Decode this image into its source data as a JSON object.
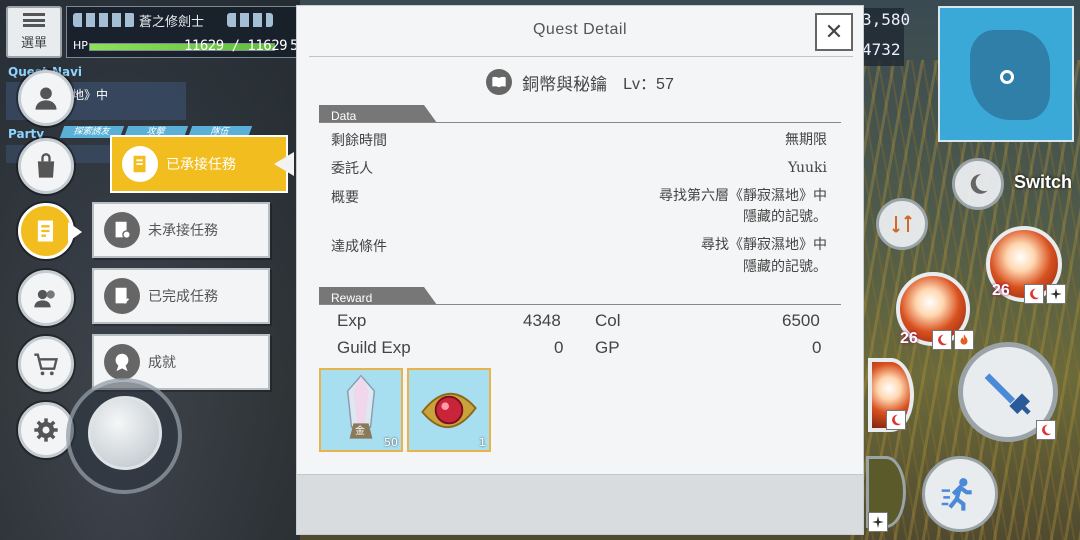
{
  "hud": {
    "menu_label": "選單",
    "player_name": "蒼之修劍士",
    "hp_label": "HP",
    "hp_text": "11629 / 11629",
    "hp_trailing": "5",
    "hp_fraction": 1.0,
    "quest_nav_label": "Quest Navi",
    "quest_nav_text": "濕地》中",
    "party_label": "Party",
    "party_tabs": [
      "探索誘友",
      "攻擊",
      "隊伍"
    ],
    "currency_1": "3,580",
    "currency_2": "4732",
    "switch_label": "Switch",
    "skill_level_1": "26",
    "skill_level_2": "26"
  },
  "side_menu": {
    "items": [
      {
        "icon": "profile-icon"
      },
      {
        "icon": "bag-icon"
      },
      {
        "icon": "quest-icon"
      },
      {
        "icon": "party-icon"
      },
      {
        "icon": "shop-icon"
      },
      {
        "icon": "gear-icon"
      }
    ],
    "submenu": {
      "active_label": "已承接任務",
      "items": [
        "未承接任務",
        "已完成任務",
        "成就"
      ]
    }
  },
  "dialog": {
    "title": "Quest Detail",
    "close_label": "✕",
    "quest_name": "銅幣與秘鑰",
    "quest_level": "Lv：57",
    "data_section": "Data",
    "rows": [
      {
        "label": "剩餘時間",
        "value": "無期限"
      },
      {
        "label": "委託人",
        "value": "Yuuki"
      },
      {
        "label": "概要",
        "value_line1": "尋找第六層《靜寂濕地》中",
        "value_line2": "隱藏的記號。"
      },
      {
        "label": "達成條件",
        "value_line1": "尋找《靜寂濕地》中",
        "value_line2": "隱藏的記號。"
      }
    ],
    "reward_section": "Reward",
    "rewards": {
      "exp_label": "Exp",
      "exp_value": "4348",
      "col_label": "Col",
      "col_value": "6500",
      "guild_exp_label": "Guild Exp",
      "guild_exp_value": "0",
      "gp_label": "GP",
      "gp_value": "0"
    },
    "items": [
      {
        "icon": "crystal-icon",
        "qty": "50",
        "card_label": "金"
      },
      {
        "icon": "ruby-brooch-icon",
        "qty": "1"
      }
    ]
  },
  "colors": {
    "accent_yellow": "#f2bd1f",
    "hp_green": "#7ed350",
    "panel_bg": "#f4f5f6"
  }
}
